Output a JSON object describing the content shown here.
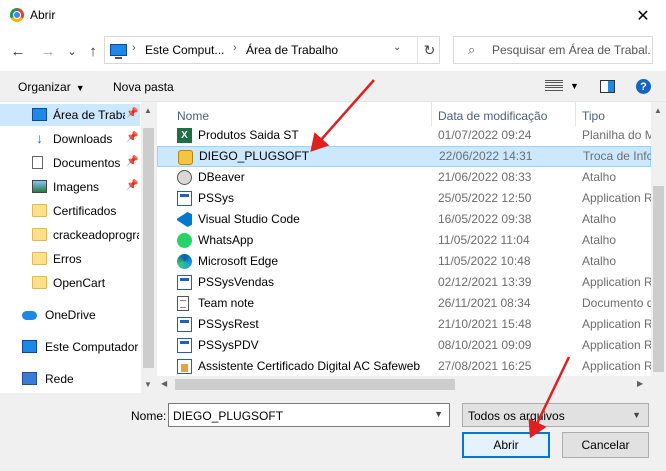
{
  "window": {
    "title": "Abrir",
    "close_glyph": "✕"
  },
  "nav": {
    "back_glyph": "←",
    "forward_glyph": "→",
    "recent_glyph": "⌄",
    "up_glyph": "↑",
    "breadcrumb": [
      "Este Comput...",
      "Área de Trabalho"
    ],
    "refresh_glyph": "↻",
    "search_placeholder": "Pesquisar em Área de Trabal..."
  },
  "toolbar": {
    "organize": "Organizar",
    "new_folder": "Nova pasta",
    "help": "?"
  },
  "sidebar": {
    "items": [
      {
        "label": "Área de Traba",
        "icon": "desktop-icon",
        "pinned": true,
        "selected": true
      },
      {
        "label": "Downloads",
        "icon": "download-icon",
        "pinned": true
      },
      {
        "label": "Documentos",
        "icon": "documents-icon",
        "pinned": true
      },
      {
        "label": "Imagens",
        "icon": "images-icon",
        "pinned": true
      },
      {
        "label": "Certificados",
        "icon": "folder-icon"
      },
      {
        "label": "crackeadoprogra",
        "icon": "folder-icon"
      },
      {
        "label": "Erros",
        "icon": "folder-icon"
      },
      {
        "label": "OpenCart",
        "icon": "folder-icon"
      }
    ],
    "roots": [
      {
        "label": "OneDrive",
        "icon": "onedrive-icon"
      },
      {
        "label": "Este Computador",
        "icon": "computer-icon"
      },
      {
        "label": "Rede",
        "icon": "network-icon"
      }
    ]
  },
  "columns": {
    "name": "Nome",
    "date": "Data de modificação",
    "type": "Tipo"
  },
  "files": [
    {
      "name": "Produtos Saida ST",
      "date": "01/07/2022 09:24",
      "type": "Planilha do Micro",
      "icon": "excel-icon"
    },
    {
      "name": "DIEGO_PLUGSOFT",
      "date": "22/06/2022 14:31",
      "type": "Troca de Informa",
      "icon": "plugin-file-icon",
      "selected": true
    },
    {
      "name": "DBeaver",
      "date": "21/06/2022 08:33",
      "type": "Atalho",
      "icon": "dbeaver-icon"
    },
    {
      "name": "PSSys",
      "date": "25/05/2022 12:50",
      "type": "Application Refer",
      "icon": "application-icon"
    },
    {
      "name": "Visual Studio Code",
      "date": "16/05/2022 09:38",
      "type": "Atalho",
      "icon": "vscode-icon"
    },
    {
      "name": "WhatsApp",
      "date": "11/05/2022 11:04",
      "type": "Atalho",
      "icon": "whatsapp-icon"
    },
    {
      "name": "Microsoft Edge",
      "date": "11/05/2022 10:48",
      "type": "Atalho",
      "icon": "edge-icon"
    },
    {
      "name": "PSSysVendas",
      "date": "02/12/2021 13:39",
      "type": "Application Refer",
      "icon": "application-icon"
    },
    {
      "name": "Team note",
      "date": "26/11/2021 08:34",
      "type": "Documento de Te",
      "icon": "text-document-icon"
    },
    {
      "name": "PSSysRest",
      "date": "21/10/2021 15:48",
      "type": "Application Refer",
      "icon": "application-icon"
    },
    {
      "name": "PSSysPDV",
      "date": "08/10/2021 09:09",
      "type": "Application Refer",
      "icon": "application-icon"
    },
    {
      "name": "Assistente Certificado Digital AC Safeweb",
      "date": "27/08/2021 16:25",
      "type": "Application Refer",
      "icon": "certificate-app-icon"
    }
  ],
  "footer": {
    "name_label": "Nome:",
    "filename": "DIEGO_PLUGSOFT",
    "filetype": "Todos os arquivos",
    "open": "Abrir",
    "cancel": "Cancelar"
  },
  "colors": {
    "selection": "#cce8ff",
    "accent": "#0078d7",
    "annotation_arrow": "#e02020"
  }
}
